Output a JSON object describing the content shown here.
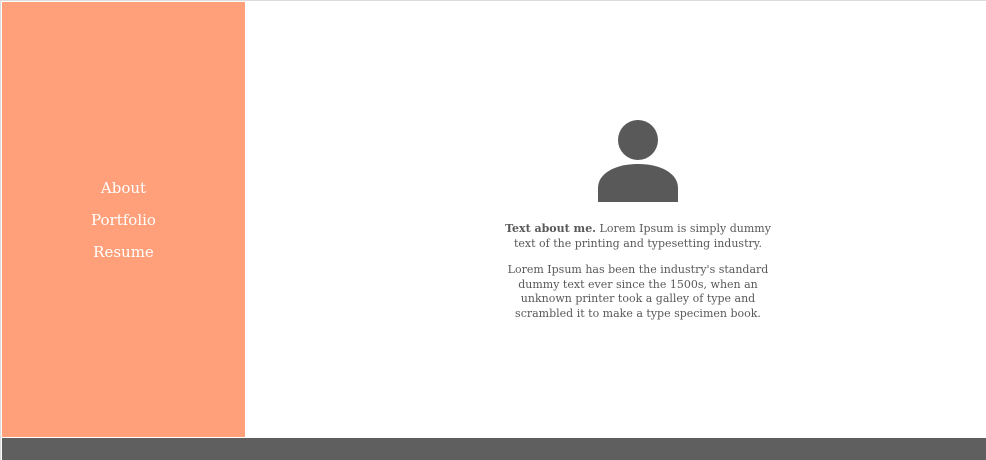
{
  "sidebar": {
    "background": "#ffa07a",
    "nav": [
      {
        "label": "About"
      },
      {
        "label": "Portfolio"
      },
      {
        "label": "Resume"
      }
    ]
  },
  "main": {
    "avatar_icon": "user-silhouette-icon",
    "intro": {
      "bold": "Text about me.",
      "text": " Lorem Ipsum is simply dummy text of the printing and typesetting industry."
    },
    "paragraph2": "Lorem Ipsum has been the industry's standard dummy text ever since the 1500s, when an unknown printer took a galley of type and scrambled it to make a type specimen book."
  },
  "footer": {
    "background": "#5f5f5f"
  }
}
